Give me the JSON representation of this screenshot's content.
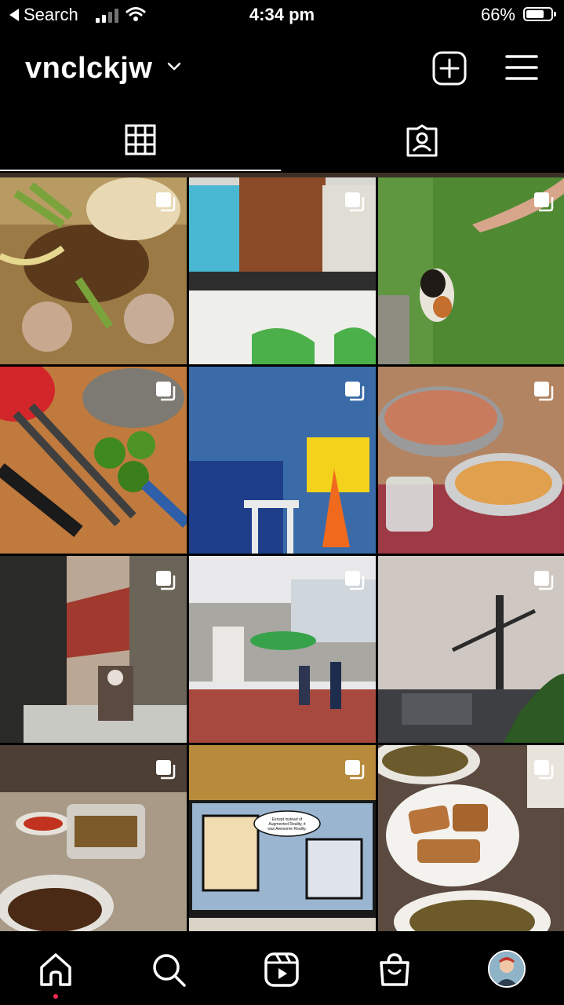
{
  "status_bar": {
    "back_label": "Search",
    "time": "4:34 pm",
    "battery_percent": "66%",
    "battery_level": 0.66
  },
  "header": {
    "username": "vnclckjw",
    "icons": [
      "chevron-down-icon",
      "add-post-icon",
      "hamburger-menu-icon"
    ]
  },
  "tabs": [
    {
      "icon": "grid-icon",
      "active": true
    },
    {
      "icon": "tagged-icon",
      "active": false
    }
  ],
  "posts": [
    {
      "subject": "noodles with minced meat",
      "multi": true
    },
    {
      "subject": "popcorn bags",
      "multi": true
    },
    {
      "subject": "calico cat on grass",
      "multi": true
    },
    {
      "subject": "limes and kitchen tools",
      "multi": true
    },
    {
      "subject": "blue tiles and traffic cone",
      "multi": true
    },
    {
      "subject": "food in pots on table",
      "multi": true
    },
    {
      "subject": "window with figure",
      "multi": true
    },
    {
      "subject": "street with umbrella",
      "multi": true
    },
    {
      "subject": "crane at dusk",
      "multi": true
    },
    {
      "subject": "takeaway food on table",
      "multi": true
    },
    {
      "subject": "TV screen with characters",
      "multi": true
    },
    {
      "subject": "fried tofu and noodles",
      "multi": true
    }
  ],
  "tv_bubble_text": "Except instead of Augmented Reality, it was Awesome Reality.",
  "bottom_nav": [
    "home-icon",
    "search-icon",
    "reels-icon",
    "shop-icon",
    "profile-avatar"
  ],
  "colors": {
    "background": "#000000",
    "notification_dot": "#ff2d55"
  }
}
